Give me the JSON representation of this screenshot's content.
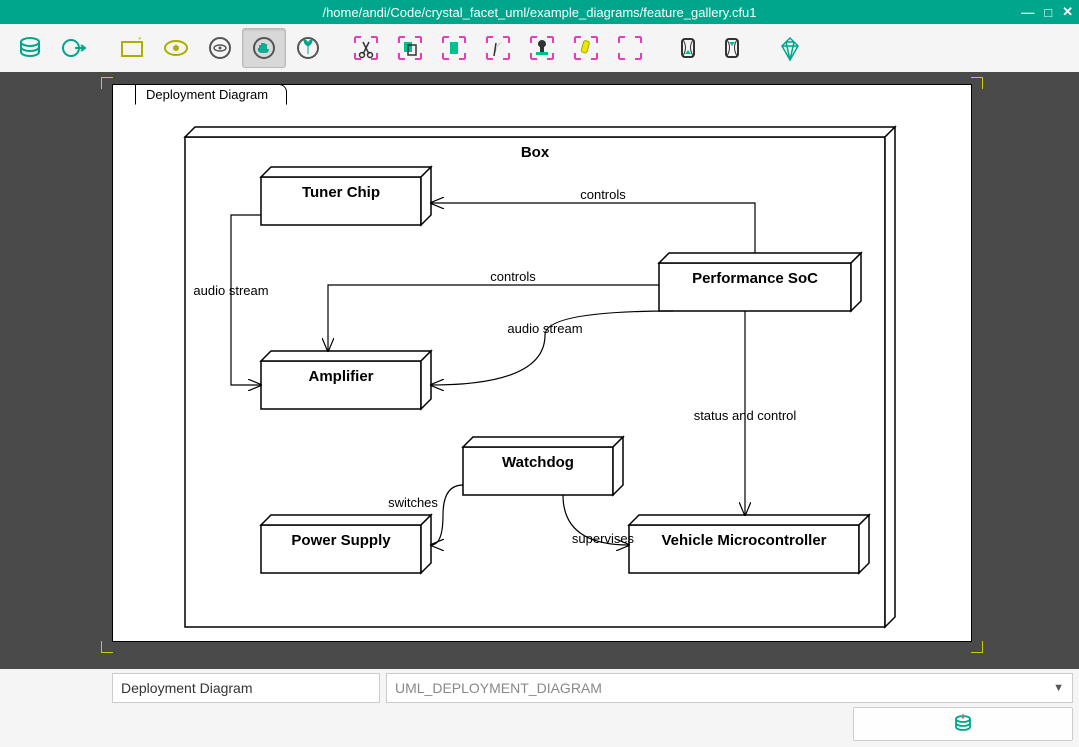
{
  "window": {
    "title": "/home/andi/Code/crystal_facet_uml/example_diagrams/feature_gallery.cfu1"
  },
  "diagram": {
    "tab_label": "Deployment Diagram",
    "container": "Box",
    "nodes": {
      "tuner": "Tuner Chip",
      "perf": "Performance SoC",
      "amp": "Amplifier",
      "watchdog": "Watchdog",
      "power": "Power Supply",
      "vmc": "Vehicle Microcontroller"
    },
    "edges": {
      "controls1": "controls",
      "controls2": "controls",
      "audio1": "audio stream",
      "audio2": "audio stream",
      "status": "status and control",
      "switches": "switches",
      "supervises": "supervises"
    }
  },
  "footer": {
    "name": "Deployment Diagram",
    "type": "UML_DEPLOYMENT_DIAGRAM"
  },
  "chart_data": {
    "type": "diagram",
    "diagram_type": "UML Deployment Diagram",
    "title": "Deployment Diagram",
    "container": "Box",
    "nodes": [
      {
        "id": "tuner",
        "label": "Tuner Chip"
      },
      {
        "id": "perf",
        "label": "Performance SoC"
      },
      {
        "id": "amp",
        "label": "Amplifier"
      },
      {
        "id": "watchdog",
        "label": "Watchdog"
      },
      {
        "id": "power",
        "label": "Power Supply"
      },
      {
        "id": "vmc",
        "label": "Vehicle Microcontroller"
      }
    ],
    "edges": [
      {
        "from": "perf",
        "to": "tuner",
        "label": "controls",
        "direction": "perf→tuner"
      },
      {
        "from": "perf",
        "to": "amp",
        "label": "controls",
        "direction": "perf→amp"
      },
      {
        "from": "tuner",
        "to": "amp",
        "label": "audio stream",
        "direction": "tuner→amp"
      },
      {
        "from": "perf",
        "to": "amp",
        "label": "audio stream",
        "direction": "perf→amp"
      },
      {
        "from": "perf",
        "to": "vmc",
        "label": "status and control",
        "direction": "bidirectional"
      },
      {
        "from": "watchdog",
        "to": "power",
        "label": "switches",
        "direction": "watchdog→power"
      },
      {
        "from": "watchdog",
        "to": "vmc",
        "label": "supervises",
        "direction": "watchdog→vmc"
      }
    ]
  }
}
